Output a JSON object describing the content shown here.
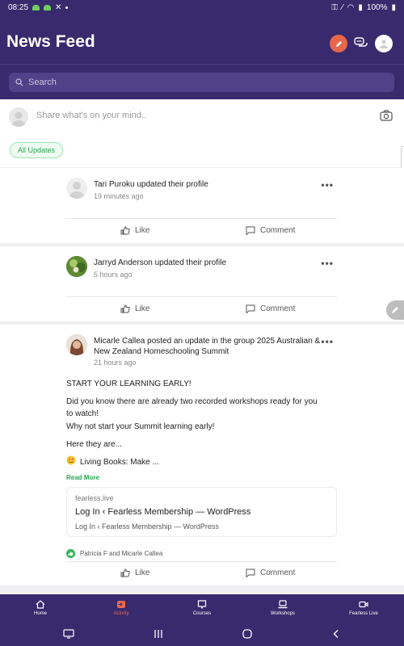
{
  "status": {
    "time": "08:25",
    "battery": "100%"
  },
  "header": {
    "title": "News Feed",
    "search_placeholder": "Search"
  },
  "share": {
    "placeholder": "Share what's on your mind..",
    "filter": "All Updates"
  },
  "posts": [
    {
      "name": "Tari Puroku",
      "action": "updated their profile",
      "time": "19 minutes ago",
      "like": "Like",
      "comment": "Comment"
    },
    {
      "name": "Jarryd Anderson",
      "action": "updated their profile",
      "time": "5 hours ago",
      "like": "Like",
      "comment": "Comment"
    },
    {
      "name": "Micarle Callea",
      "action": "posted an update in the group",
      "group": "2025 Australian & New Zealand Homeschooling Summit",
      "time": "21 hours ago",
      "lines": [
        "START YOUR LEARNING EARLY!",
        "Did you know there are already two recorded workshops ready for you to watch!",
        "Why not start your Summit learning early!",
        "Here they are...",
        "Living Books: Make ..."
      ],
      "read_more": "Read More",
      "link": {
        "domain": "fearless.live",
        "title": "Log In ‹ Fearless Membership — WordPress",
        "desc": "Log In ‹ Fearless Membership — WordPress"
      },
      "likers": "Patricia F and Micarle Callea",
      "like": "Like",
      "comment": "Comment"
    }
  ],
  "nav": [
    {
      "label": "Home",
      "icon": "home-icon"
    },
    {
      "label": "Activity",
      "icon": "activity-icon",
      "active": true
    },
    {
      "label": "Courses",
      "icon": "courses-icon"
    },
    {
      "label": "Workshops",
      "icon": "workshops-icon"
    },
    {
      "label": "Fearless Live",
      "icon": "video-icon"
    }
  ],
  "colors": {
    "brand": "#382a6d",
    "accent": "#e8674c",
    "green": "#2aa653"
  }
}
